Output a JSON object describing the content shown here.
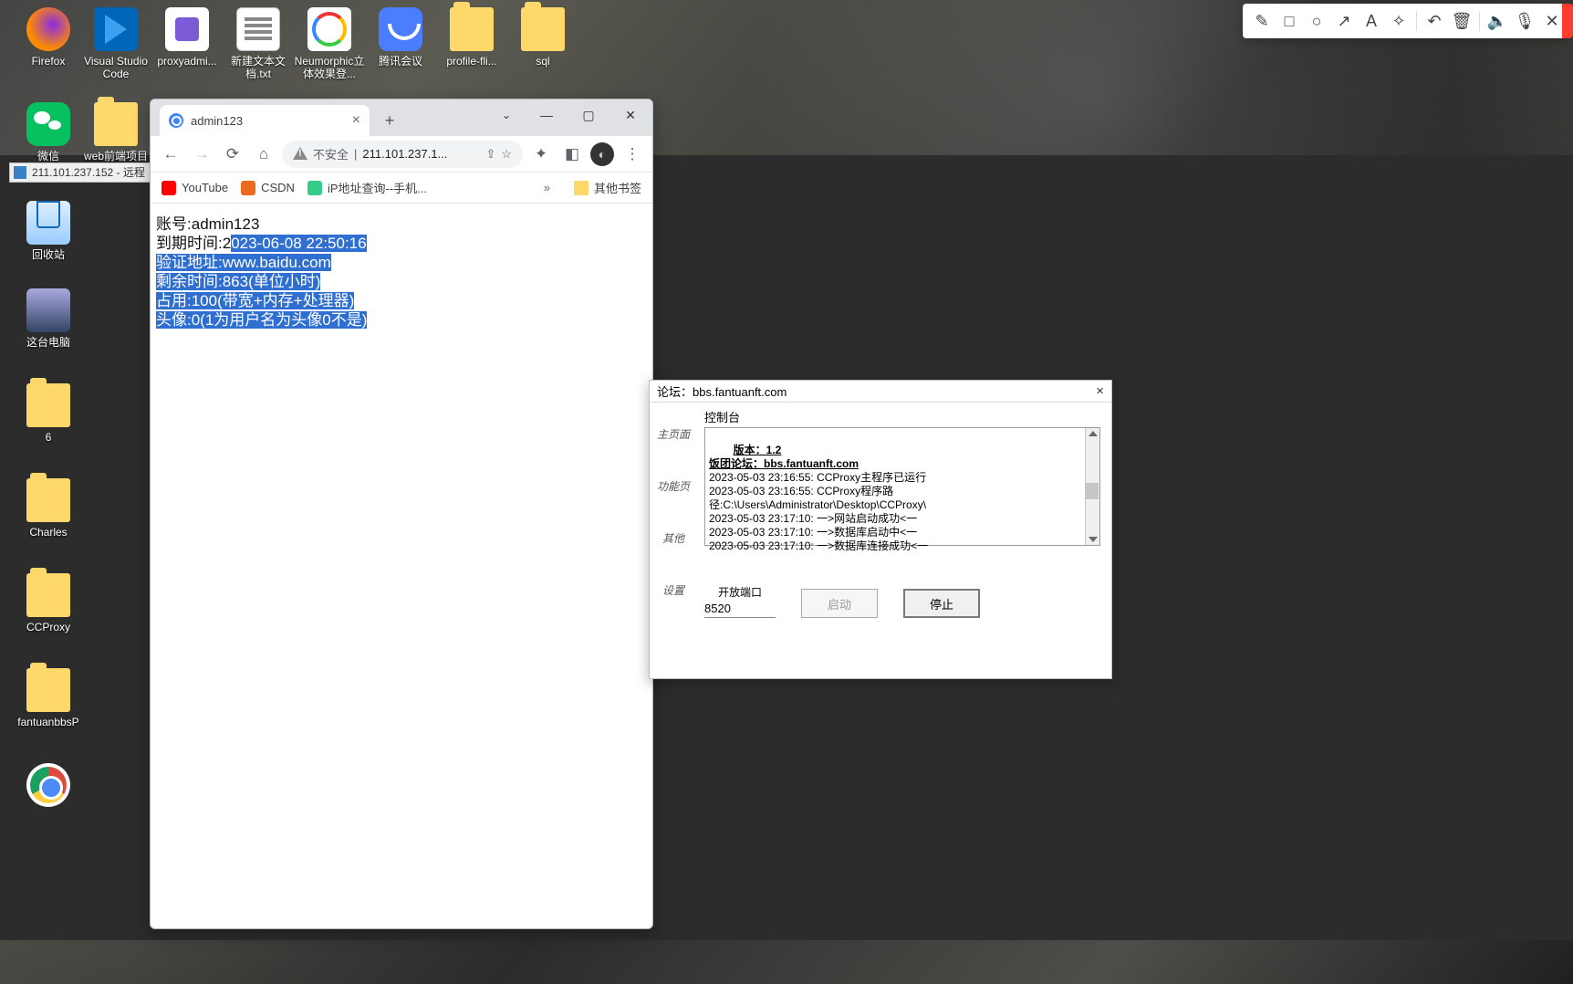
{
  "desktop_icons": {
    "r1": [
      {
        "label": "Firefox"
      },
      {
        "label": "Visual Studio Code"
      },
      {
        "label": "proxyadmi..."
      },
      {
        "label": "新建文本文档.txt"
      },
      {
        "label": "Neumorphic立体效果登..."
      },
      {
        "label": "腾讯会议"
      },
      {
        "label": "profile-fli..."
      },
      {
        "label": "sql"
      }
    ],
    "r2": [
      {
        "label": "微信"
      },
      {
        "label": "web前端项目"
      }
    ],
    "left_col": [
      {
        "label": "回收站"
      },
      {
        "label": "这台电脑"
      },
      {
        "label": "6"
      },
      {
        "label": "Charles"
      },
      {
        "label": "CCProxy"
      },
      {
        "label": "fantuanbbsP"
      }
    ]
  },
  "rdp_taskbar": "211.101.237.152 - 远程",
  "chrome": {
    "tab_title": "admin123",
    "security_text": "不安全",
    "url": "211.101.237.1...",
    "bookmarks": {
      "yt": "YouTube",
      "csdn": "CSDN",
      "ip": "iP地址查询--手机...",
      "more": "»",
      "other": "其他书签"
    },
    "page": {
      "l1_prefix": "账号:",
      "l1_value": "admin123",
      "l2_prefix": "到期时间:2",
      "l2_sel": "023-06-08 22:50:16",
      "l3": "验证地址:www.baidu.com",
      "l4": "剩余时间:863(单位小时)",
      "l5": "占用:100(带宽+内存+处理器)",
      "l6": "头像:0(1为用户名为头像0不是)"
    }
  },
  "console": {
    "title": "论坛：bbs.fantuanft.com",
    "panel_label": "控制台",
    "tabs": [
      "主页面",
      "功能页",
      "其他",
      "设置"
    ],
    "header_line": "版本：1.2\n饭团论坛：bbs.fantuanft.com",
    "log": "2023-05-03 23:16:55: CCProxy主程序已运行\n2023-05-03 23:16:55: CCProxy程序路径:C:\\Users\\Administrator\\Desktop\\CCProxy\\\n2023-05-03 23:17:10: 一>网站启动成功<一\n2023-05-03 23:17:10: 一>数据库启动中<一\n2023-05-03 23:17:10: 一>数据库连接成功<一",
    "port_label": "开放端口",
    "port_value": "8520",
    "start": "启动",
    "stop": "停止"
  }
}
